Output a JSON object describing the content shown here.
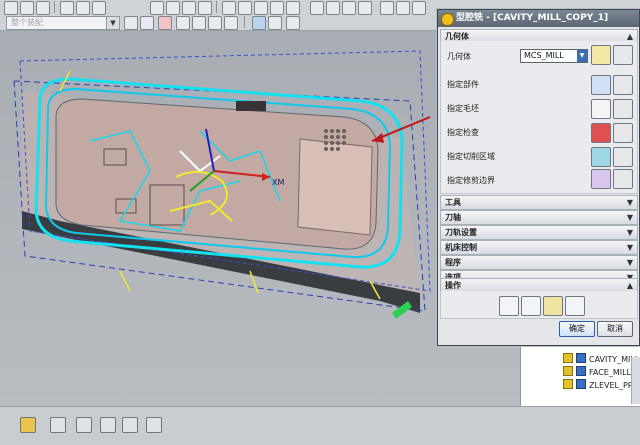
{
  "toolbar": {
    "filter_combo": "整个装配"
  },
  "dialog": {
    "title": "型腔铣 - [CAVITY_MILL_COPY_1]",
    "geometry": {
      "header": "几何体",
      "geometry_label": "几何体",
      "geometry_value": "MCS_MILL",
      "specify_part": "指定部件",
      "specify_blank": "指定毛坯",
      "specify_check": "指定检查",
      "specify_cut_area": "指定切削区域",
      "specify_trim": "指定修剪边界"
    },
    "sections": [
      "工具",
      "刀轴",
      "刀轨设置",
      "机床控制",
      "程序",
      "选项"
    ],
    "actions_header": "操作",
    "ok": "确定",
    "cancel": "取消"
  },
  "nav_tree": {
    "items": [
      "CAVITY_MILL_C",
      "FACE_MILLING_",
      "ZLEVEL_PROFILE"
    ]
  },
  "viewport": {
    "axis_label": "XM"
  }
}
